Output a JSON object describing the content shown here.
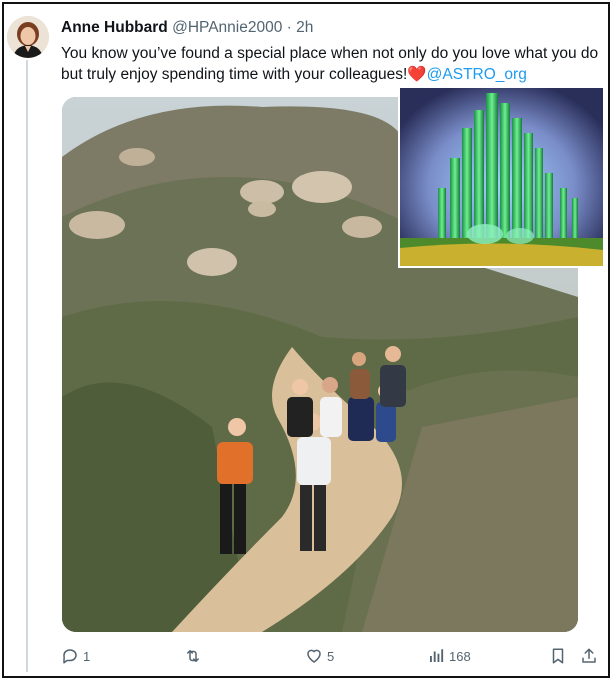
{
  "tweet": {
    "author_name": "Anne Hubbard",
    "handle": "@HPAnnie2000",
    "separator": "·",
    "time": "2h",
    "text_main": "You know you’ve found a special place when not only do you love what you do but truly enjoy spending time with your colleagues!",
    "mention": "@ASTRO_org"
  },
  "media": {
    "main_photo": "group-hiking-trail-photo",
    "inset_photo": "emerald-city-image"
  },
  "actions": {
    "reply_count": "1",
    "retweet_count": "",
    "like_count": "5",
    "view_count": "168"
  },
  "colors": {
    "text": "#0f1419",
    "muted": "#536471",
    "link": "#1d9bf0",
    "heart": "#e0245e"
  }
}
